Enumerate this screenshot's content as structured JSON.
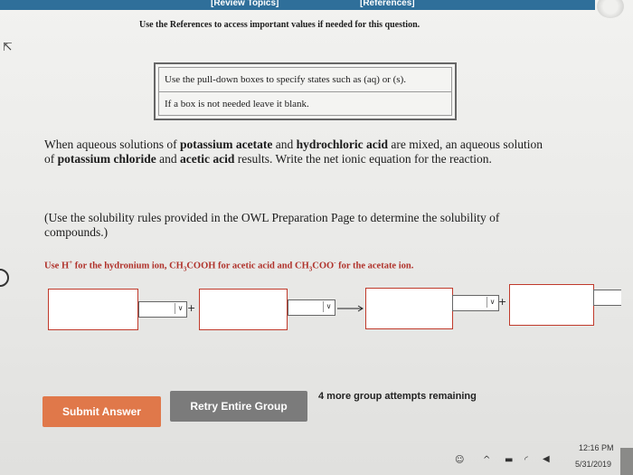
{
  "header": {
    "review_topics": "[Review Topics]",
    "references": "[References]",
    "notice": "Use the References to access important values if needed for this question."
  },
  "hints": {
    "line1": "Use the pull-down boxes to specify states such as (aq) or (s).",
    "line2": "If a box is not needed leave it blank."
  },
  "question": {
    "p1_before": "When aqueous solutions of ",
    "reactant1": "potassium acetate",
    "p1_and": " and ",
    "reactant2": "hydrochloric acid",
    "p1_middle": " are mixed, an aqueous solution of ",
    "product1": "potassium chloride",
    "p1_and2": " and ",
    "product2": "acetic acid",
    "p1_after": " results. Write the net ionic equation for the reaction.",
    "solubility_note": "(Use the solubility rules provided in the OWL Preparation Page to determine the solubility of compounds.)"
  },
  "red_instruction": {
    "use": "Use H",
    "h_charge": "+",
    "for_hydronium": " for the hydronium ion, CH",
    "sub3a": "3",
    "acetic": "COOH for acetic acid and CH",
    "sub3b": "3",
    "coo": "COO",
    "coo_charge": "-",
    "acetate": " for the acetate ion."
  },
  "equation": {
    "plus": "+",
    "chevron": "∨"
  },
  "buttons": {
    "submit": "Submit Answer",
    "retry": "Retry Entire Group"
  },
  "remaining": "4 more group attempts remaining",
  "taskbar": {
    "time": "12:16 PM",
    "date": "5/31/2019"
  },
  "colors": {
    "submit": "#e0784a",
    "retry": "#7b7b7b",
    "instruction_red": "#b0322b"
  }
}
